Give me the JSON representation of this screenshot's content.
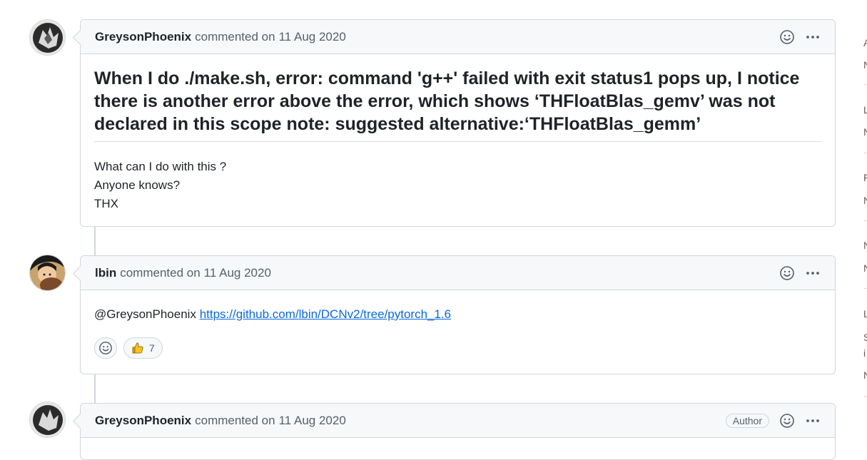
{
  "comments": [
    {
      "author": "GreysonPhoenix",
      "meta": "commented on",
      "date": "11 Aug 2020",
      "heading": "When I do ./make.sh, error: command 'g++' failed with exit status1 pops up, I notice there is another error above the error, which shows ‘THFloatBlas_gemv’ was not declared in this scope note: suggested alternative:‘THFloatBlas_gemm’",
      "lines": [
        "What can I do with this ?",
        "Anyone knows?",
        "THX"
      ]
    },
    {
      "author": "lbin",
      "meta": "commented on",
      "date": "11 Aug 2020",
      "mention": "@GreysonPhoenix",
      "link": "https://github.com/lbin/DCNv2/tree/pytorch_1.6",
      "reactions": {
        "thumbs_up_count": "7"
      }
    },
    {
      "author": "GreysonPhoenix",
      "meta": "commented on",
      "date": "11 Aug 2020",
      "badge": "Author"
    }
  ],
  "sidebar": {
    "fragments": [
      "A",
      "N",
      "L",
      "N",
      "F",
      "N",
      "N",
      "N",
      "L",
      "S",
      "i",
      "N"
    ]
  },
  "icons": {
    "smiley": "smiley-icon",
    "kebab": "kebab-horizontal-icon",
    "thumbs_up": "thumbs-up-icon"
  },
  "colors": {
    "link": "#0969da",
    "border": "#d0d7de",
    "header_bg": "#f6f8fa",
    "thumb": "#e3a008"
  }
}
